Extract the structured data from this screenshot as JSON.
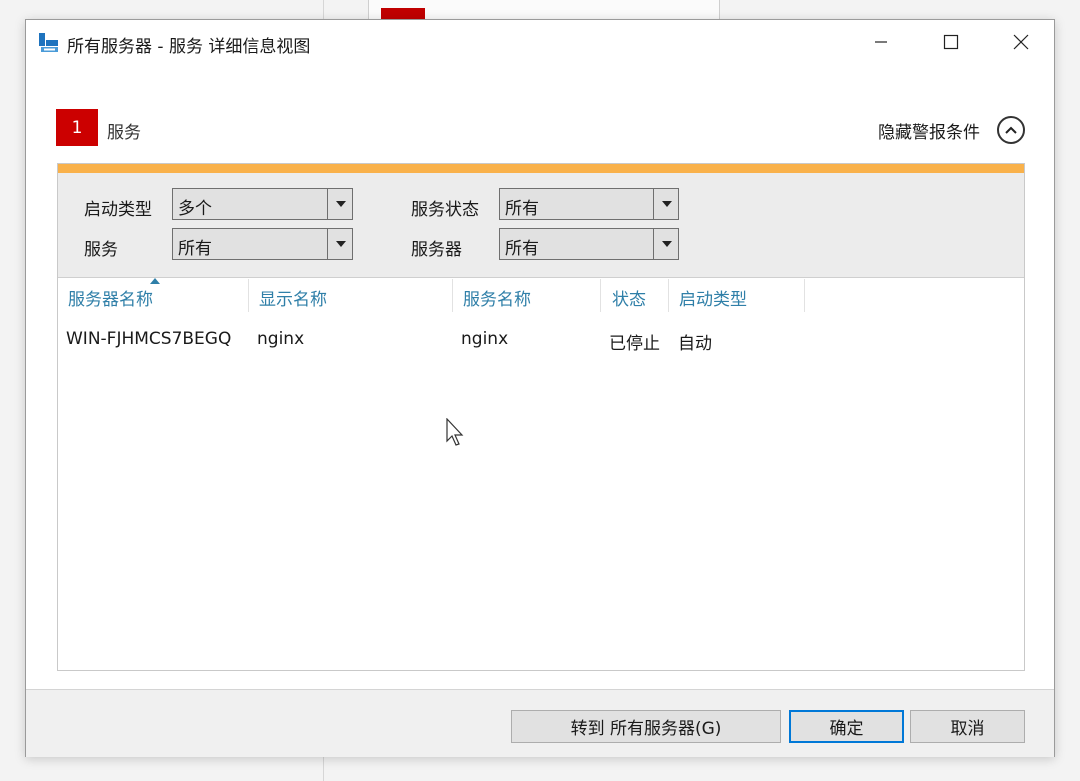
{
  "window": {
    "title": "所有服务器 - 服务 详细信息视图"
  },
  "section": {
    "badge": "1",
    "title": "服务",
    "toggle_label": "隐藏警报条件"
  },
  "filters": {
    "startup_type": {
      "label": "启动类型",
      "value": "多个"
    },
    "service": {
      "label": "服务",
      "value": "所有"
    },
    "service_status": {
      "label": "服务状态",
      "value": "所有"
    },
    "server": {
      "label": "服务器",
      "value": "所有"
    }
  },
  "table": {
    "columns": [
      "服务器名称",
      "显示名称",
      "服务名称",
      "状态",
      "启动类型"
    ],
    "rows": [
      [
        "WIN-FJHMCS7BEGQ",
        "nginx",
        "nginx",
        "已停止",
        "自动"
      ]
    ]
  },
  "footer": {
    "goto_label": "转到 所有服务器(G)",
    "ok_label": "确定",
    "cancel_label": "取消"
  },
  "colors": {
    "accent_red": "#cc0000",
    "alert_bar": "#f9b14a",
    "header_text": "#2f7fa8",
    "focus_border": "#0078d7"
  }
}
